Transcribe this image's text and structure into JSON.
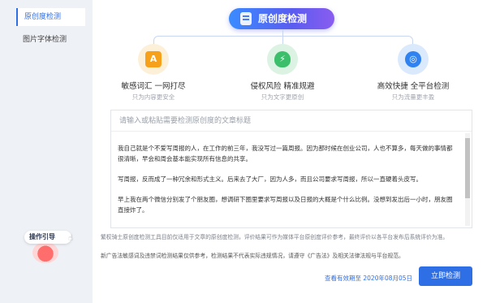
{
  "sidebar": {
    "items": [
      {
        "label": "原创度检测"
      },
      {
        "label": "图片字体检测"
      }
    ],
    "guide_label": "操作引导"
  },
  "header": {
    "title": "原创度检测"
  },
  "features": [
    {
      "title": "敏感词汇 一网打尽",
      "subtitle": "只为内容更安全",
      "icon": "document-a-icon",
      "color": "#f7a11b"
    },
    {
      "title": "侵权风险 精准规避",
      "subtitle": "只为文字更原创",
      "icon": "shield-lightning-icon",
      "color": "#3cbf6a"
    },
    {
      "title": "高效快捷 全平台检测",
      "subtitle": "只为流量更丰盈",
      "icon": "target-icon",
      "color": "#2f82ef"
    }
  ],
  "editor": {
    "title_placeholder": "请输入或粘贴需要检测原创度的文章标题",
    "paragraphs": [
      "我自己就是个不爱写周报的人，在工作的前三年，我没写过一篇周报。因为那时候在创业公司，人也不算多，每天做的事情都很清晰，早会和周会基本能实现所有信息的共享。",
      "写周报，反而成了一种冗余和形式主义。后来去了大厂，因为人多，而且公司要求写周报，所以一直硬着头皮写。",
      "早上我在两个微信分别发了个朋友圈，想调研下圈里要求写周报以及日报的大概是个什么比例。没想到发出后一小时，朋友圈直接炸了。"
    ]
  },
  "notes": {
    "disclaimer": "繁权骑士原创度检测工具目前仅适用于文章的原创度检测，评价结果可作为媒体平台原创度评价参考，最终评价以各平台发布后系统评价为准。",
    "ad_law": "新广告法敏感词及违禁词检测结果仅供参考，检测结果不代表实际违规情况，请遵守《广告法》及相关法律法规与平台规范。"
  },
  "footer": {
    "deadline": "查看有效期至 2020年08月05日",
    "check_button": "立即检测"
  },
  "colors": {
    "accent": "#2f6fe6",
    "badge_start": "#3a8cff",
    "badge_end": "#8a5cf0"
  }
}
